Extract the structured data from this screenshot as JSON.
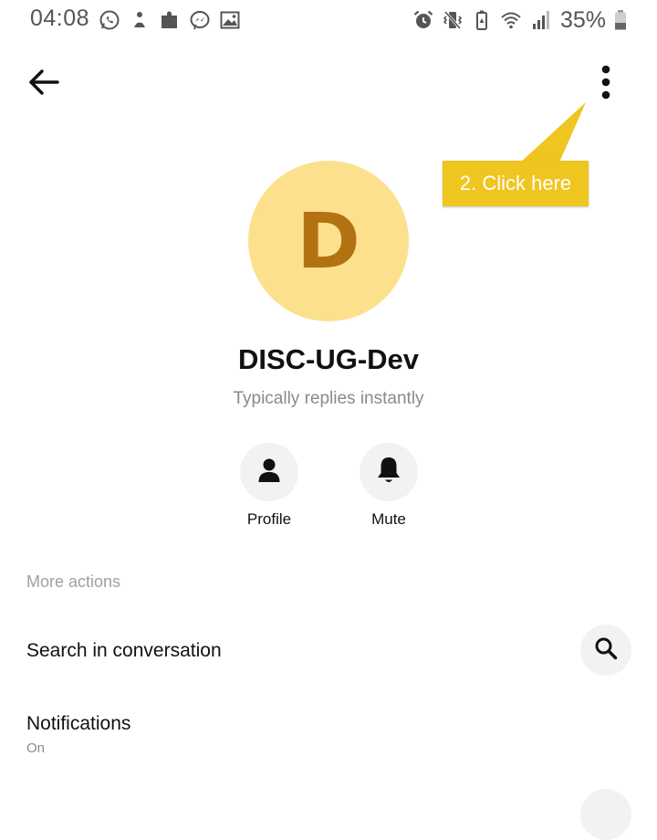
{
  "status_bar": {
    "time": "04:08",
    "battery_percent": "35%",
    "left_icons": [
      "whatsapp-icon",
      "notification-app-icon",
      "puzzle-icon",
      "messenger-icon",
      "gallery-icon"
    ],
    "right_icons": [
      "alarm-icon",
      "vibrate-icon",
      "battery-saver-icon",
      "wifi-icon",
      "signal-icon",
      "battery-icon"
    ]
  },
  "header": {
    "back_icon": "arrow-left-icon",
    "menu_icon": "more-vertical-icon"
  },
  "callout": {
    "text": "2. Click here",
    "color": "#efc51f"
  },
  "contact": {
    "avatar_letter": "D",
    "avatar_bg": "#fde08e",
    "avatar_fg": "#b37212",
    "name": "DISC-UG-Dev",
    "subtitle": "Typically replies instantly"
  },
  "quick_actions": [
    {
      "label": "Profile",
      "icon": "person-icon"
    },
    {
      "label": "Mute",
      "icon": "bell-icon"
    }
  ],
  "more_actions": {
    "header": "More actions",
    "items": [
      {
        "title": "Search in conversation",
        "icon": "search-icon"
      },
      {
        "title": "Notifications",
        "subtitle": "On"
      }
    ]
  }
}
